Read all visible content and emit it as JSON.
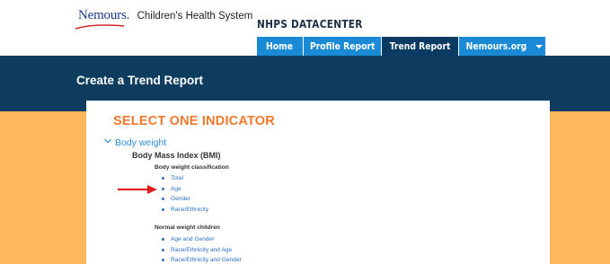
{
  "header": {
    "brand": "Nemours",
    "brand_dot": ".",
    "tagline": "Children's Health System",
    "datacenter_title": "NHPS DATACENTER"
  },
  "nav": {
    "tabs": [
      {
        "label": "Home",
        "active": false
      },
      {
        "label": "Profile Report",
        "active": false
      },
      {
        "label": "Trend Report",
        "active": true
      },
      {
        "label": "Nemours.org",
        "active": false,
        "dropdown": true
      }
    ]
  },
  "banner": {
    "title": "Create a Trend Report"
  },
  "indicator": {
    "heading": "SELECT ONE INDICATOR",
    "category": {
      "label": "Body weight",
      "icon": "chevron-down-icon",
      "expanded": true
    },
    "measure": "Body Mass Index (BMI)",
    "subgroups": [
      {
        "label": "Body weight classification",
        "items": [
          "Total",
          "Age",
          "Gender",
          "Race/Ethnicity"
        ]
      },
      {
        "label": "Normal weight children",
        "items": [
          "Age and Gender",
          "Race/Ethnicity and Age",
          "Race/Ethnicity and Gender"
        ]
      }
    ]
  },
  "annotation": {
    "icon": "red-arrow-icon",
    "points_to": "Age"
  },
  "colors": {
    "nav_tab": "#1a8ad6",
    "nav_tab_active": "#0b3b63",
    "banner": "#0d3c5e",
    "orange_background": "#fdb85c",
    "heading_orange": "#f2782c",
    "link_blue": "#2b6fc5",
    "arrow_red": "#e01b1b"
  }
}
